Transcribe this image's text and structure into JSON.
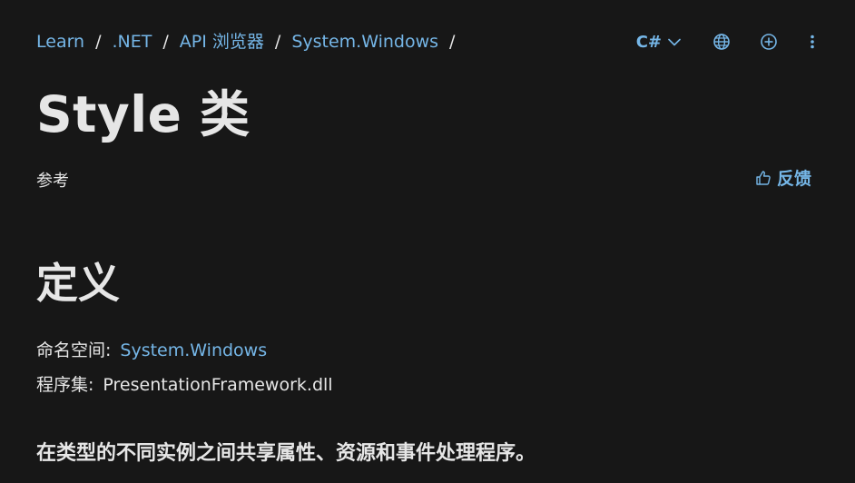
{
  "breadcrumb": {
    "items": [
      "Learn",
      ".NET",
      "API 浏览器",
      "System.Windows"
    ],
    "separator": "/"
  },
  "toolbar": {
    "language": "C#",
    "icons": [
      "chevron-down-icon",
      "globe-icon",
      "add-circle-icon",
      "more-vertical-icon"
    ]
  },
  "page": {
    "title": "Style 类",
    "reference_label": "参考",
    "feedback_label": "反馈"
  },
  "definition": {
    "heading": "定义",
    "namespace_label": "命名空间:",
    "namespace_value": "System.Windows",
    "assembly_label": "程序集:",
    "assembly_value": "PresentationFramework.dll",
    "summary": "在类型的不同实例之间共享属性、资源和事件处理程序。"
  },
  "colors": {
    "background": "#171717",
    "text": "#e6e6e6",
    "link": "#75b6e7"
  }
}
